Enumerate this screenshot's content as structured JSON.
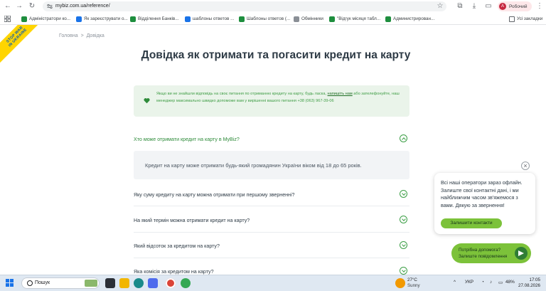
{
  "browser": {
    "url": "mybiz.com.ua/reference/",
    "profile": {
      "initial": "А",
      "label": "Робочий"
    },
    "bookmarks": [
      {
        "label": "Адміністратори ко...",
        "icon": "sheets-icon"
      },
      {
        "label": "Як зареєструвати о...",
        "icon": "docs-icon"
      },
      {
        "label": "Відділення Банків...",
        "icon": "sheets-icon"
      },
      {
        "label": "шаблоны ответов ...",
        "icon": "docs-icon"
      },
      {
        "label": "Шаблоны ответов (...",
        "icon": "sheets-icon"
      },
      {
        "label": "Обмінники",
        "icon": "globe-icon"
      },
      {
        "label": "\"Відгук місяця табл...",
        "icon": "sheets-icon"
      },
      {
        "label": "Администрирован...",
        "icon": "sheets-icon"
      }
    ],
    "all_bookmarks": "Усі закладки"
  },
  "ribbon": {
    "line1": "STOP WAR",
    "line2": "IN UKRAINE"
  },
  "breadcrumb": {
    "home": "Головна",
    "separator": ">",
    "current": "Довідка"
  },
  "page_title": "Довідка як отримати та погасити кредит на карту",
  "info": {
    "before_link": "Якщо ви не знайшли відповідь на своє питання по отриманню кредиту на карту, будь ласка, ",
    "link": "напишіть нам",
    "after_link": " або зателефонуйте, наш менеджер максимально швидко допоможе вам у вирішенні вашого питання +38 (063) 967-39-06"
  },
  "faq": [
    {
      "question": "Хто може отримати кредит на карту в MyBiz?",
      "open": true,
      "answer": "Кредит на карту може отримати будь-який громадянин України віком від 18 до 65 років."
    },
    {
      "question": "Яку суму кредиту на карту можна отримати при першому зверненні?",
      "open": false
    },
    {
      "question": "На який термін можна отримати кредит на карту?",
      "open": false
    },
    {
      "question": "Який відсоток за кредитом на карту?",
      "open": false
    },
    {
      "question": "Яка комісія за кредитом на карту?",
      "open": false
    }
  ],
  "chat": {
    "close": "×",
    "message": "Всі наші оператори зараз офлайн. Залиште свої контактні дані, і ми найближчим часом зв'яжемося з вами. Дякую за звернення!",
    "button": "Залишити контакти",
    "help_line1": "Потрібна допомога?",
    "help_line2": "Залиште повідомлення"
  },
  "taskbar": {
    "search": "Пошук",
    "weather_temp": "27°C",
    "weather_desc": "Sunny",
    "language": "УКР",
    "battery": "48%",
    "time": "17:05",
    "date": "27.08.2026"
  },
  "colors": {
    "accent": "#7cc23a",
    "accent_dark": "#2e8b3a",
    "info_bg": "#eaf4ea"
  }
}
